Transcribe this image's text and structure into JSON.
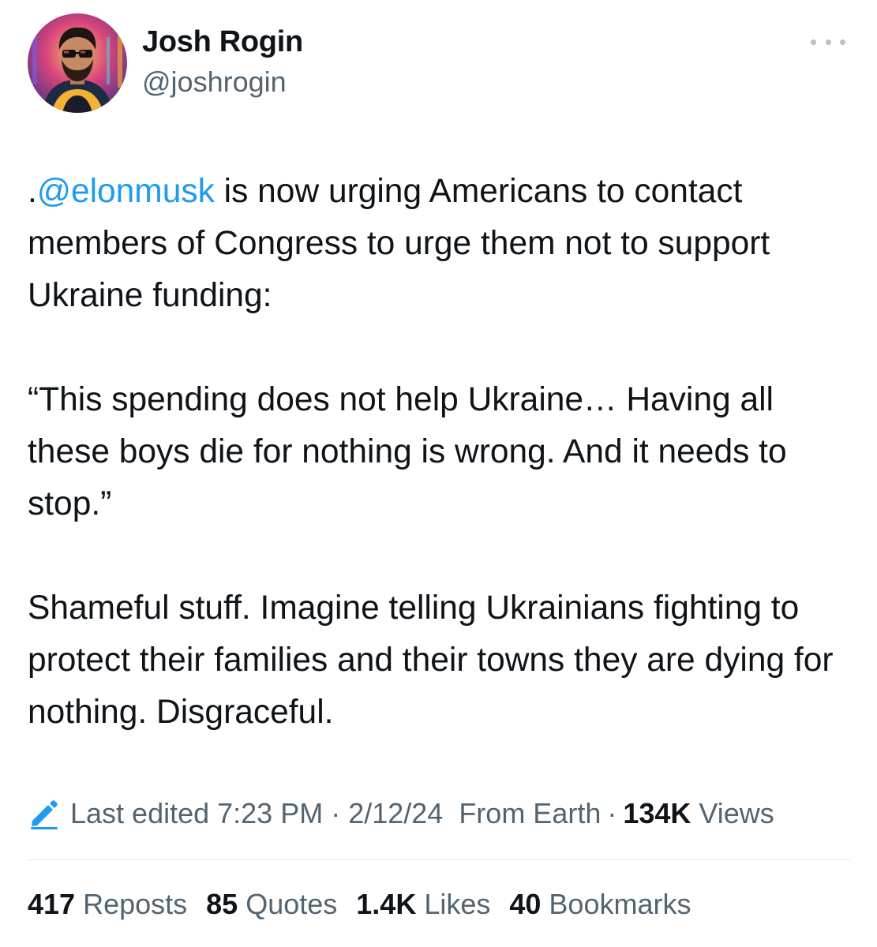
{
  "author": {
    "display_name": "Josh Rogin",
    "handle": "@joshrogin",
    "avatar_icon": "avatar-icon"
  },
  "more_icon": "more-horizontal-icon",
  "tweet": {
    "mention": "@elonmusk",
    "p1_prefix": ".",
    "p1_rest": " is now urging Americans to contact members of Congress to urge them not to support Ukraine funding:",
    "p2": "“This spending does not help Ukraine… Having all these boys die for nothing is wrong. And it needs to stop.”",
    "p3": "Shameful stuff. Imagine telling Ukrainians fighting to protect their families and their towns they are dying for nothing. Disgraceful."
  },
  "meta": {
    "edit_icon": "pencil-icon",
    "edited_label": "Last edited 7:23 PM · 2/12/24",
    "source": "From Earth",
    "separator": "·",
    "views_count": "134K",
    "views_label": "Views"
  },
  "stats": [
    {
      "count": "417",
      "label": "Reposts"
    },
    {
      "count": "85",
      "label": "Quotes"
    },
    {
      "count": "1.4K",
      "label": "Likes"
    },
    {
      "count": "40",
      "label": "Bookmarks"
    }
  ],
  "colors": {
    "link": "#1d9bf0",
    "text": "#0f1419",
    "secondary": "#536471",
    "divider": "#e3e7ea"
  }
}
